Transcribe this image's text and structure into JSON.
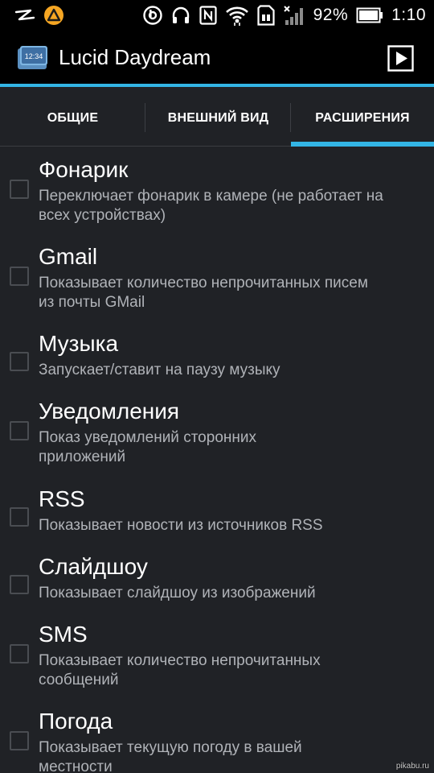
{
  "status_bar": {
    "battery_percent": "92%",
    "time": "1:10",
    "icons": [
      "zte-logo-icon",
      "warning-triangle-icon",
      "beats-icon",
      "headphones-icon",
      "nfc-icon",
      "wifi-icon",
      "sd-card-icon",
      "signal-icon",
      "battery-icon"
    ]
  },
  "action_bar": {
    "title": "Lucid Daydream",
    "icon_text": "12:34",
    "play_icon": "play-icon"
  },
  "tabs": [
    {
      "label": "ОБЩИЕ",
      "active": false
    },
    {
      "label": "ВНЕШНИЙ ВИД",
      "active": false
    },
    {
      "label": "РАСШИРЕНИЯ",
      "active": true
    }
  ],
  "settings": [
    {
      "title": "Фонарик",
      "desc1": "Переключает фонарик в камере (не работает на",
      "desc2": "всех устройствах)",
      "checked": false
    },
    {
      "title": "Gmail",
      "desc1": "Показывает количество непрочитанных писем",
      "desc2": "из почты GMail",
      "checked": false
    },
    {
      "title": "Музыка",
      "desc1": "Запускает/ставит на паузу музыку",
      "desc2": "",
      "checked": false
    },
    {
      "title": "Уведомления",
      "desc1": "Показ уведомлений сторонних",
      "desc2": "приложений",
      "checked": false
    },
    {
      "title": "RSS",
      "desc1": "Показывает новости из источников RSS",
      "desc2": "",
      "checked": false
    },
    {
      "title": "Слайдшоу",
      "desc1": "Показывает слайдшоу из изображений",
      "desc2": "",
      "checked": false
    },
    {
      "title": "SMS",
      "desc1": "Показывает количество непрочитанных",
      "desc2": "сообщений",
      "checked": false
    },
    {
      "title": "Погода",
      "desc1": "Показывает текущую погоду в вашей",
      "desc2": "местности",
      "checked": false
    }
  ],
  "watermark": "pikabu.ru",
  "colors": {
    "accent": "#33b5e5",
    "background": "#202226",
    "secondary_text": "#b0b3b8"
  }
}
